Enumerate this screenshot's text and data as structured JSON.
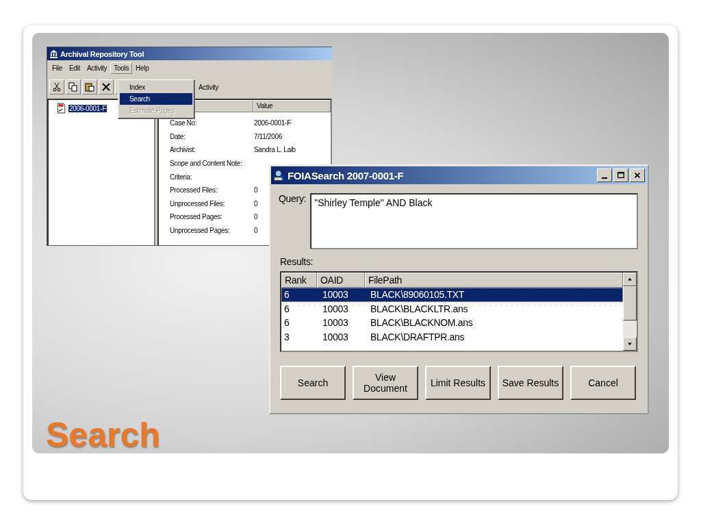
{
  "slide": {
    "title": "Search"
  },
  "main_window": {
    "title": "Archival Repository Tool",
    "menu": [
      {
        "label": "File",
        "selected": false
      },
      {
        "label": "Edit",
        "selected": false
      },
      {
        "label": "Activity",
        "selected": false
      },
      {
        "label": "Tools",
        "selected": true
      },
      {
        "label": "Help",
        "selected": false
      }
    ],
    "dropdown": [
      {
        "label": "Index",
        "selected": false,
        "disabled": false
      },
      {
        "label": "Search",
        "selected": true,
        "disabled": false
      },
      {
        "label": "Estimate Pages",
        "selected": false,
        "disabled": true
      }
    ],
    "tree": [
      {
        "label": "2006-0001-F",
        "selected": true
      }
    ],
    "panel_title": "Activity",
    "value_header": "Value",
    "properties": [
      {
        "name": "Case No:",
        "value": "2006-0001-F"
      },
      {
        "name": "Date:",
        "value": "7/11/2006"
      },
      {
        "name": "Archivist:",
        "value": "Sandra L. Laib"
      },
      {
        "name": "Scope and Content Note:"
      },
      {
        "name": "Criteria:"
      },
      {
        "name": "Processed Files:",
        "value": "0"
      },
      {
        "name": "Unprocessed Files:",
        "value": "0"
      },
      {
        "name": "Processed Pages:",
        "value": "0"
      },
      {
        "name": "Unprocessed Pages:",
        "value": "0"
      }
    ]
  },
  "dialog": {
    "title": "FOIASearch 2007-0001-F",
    "query_label": "Query:",
    "query": "\"Shirley Temple\" AND Black",
    "results_label": "Results:",
    "columns": [
      "Rank",
      "OAID",
      "FilePath"
    ],
    "rows": [
      {
        "cells": [
          "6",
          "10003",
          "BLACK\\89060105.TXT"
        ],
        "selected": true
      },
      {
        "cells": [
          "6",
          "10003",
          "BLACK\\BLACKLTR.ans"
        ],
        "selected": false
      },
      {
        "cells": [
          "6",
          "10003",
          "BLACK\\BLACKNOM.ans"
        ],
        "selected": false
      },
      {
        "cells": [
          "3",
          "10003",
          "BLACK\\DRAFTPR.ans"
        ],
        "selected": false
      }
    ],
    "buttons": [
      "Search",
      "View Document",
      "Limit Results",
      "Save Results",
      "Cancel"
    ]
  }
}
